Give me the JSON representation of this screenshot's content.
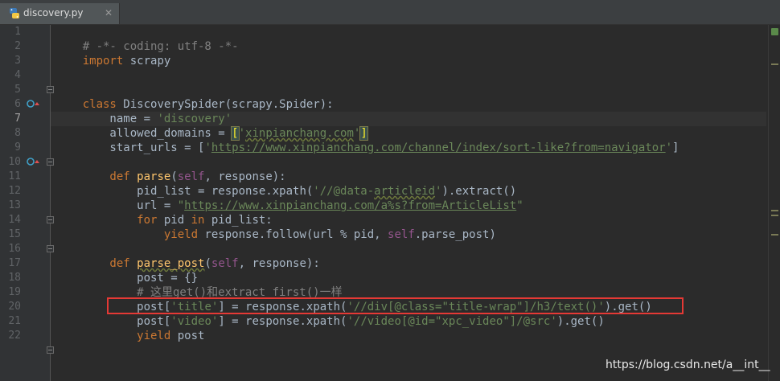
{
  "tab": {
    "filename": "discovery.py",
    "close_glyph": "✕",
    "icon": "python-file-icon"
  },
  "line_numbers": [
    "1",
    "2",
    "3",
    "4",
    "5",
    "6",
    "7",
    "8",
    "9",
    "10",
    "11",
    "12",
    "13",
    "14",
    "15",
    "16",
    "17",
    "18",
    "19",
    "20",
    "21",
    "22"
  ],
  "current_line": "7",
  "code": {
    "l1": "# -*- coding: utf-8 -*-",
    "l2_kw": "import",
    "l2_rest": " scrapy",
    "l5_kw": "class",
    "l5_rest": " DiscoverySpider(scrapy.Spider):",
    "l6_a": "    name = ",
    "l6_str": "'discovery'",
    "l7_a": "    allowed_domains = ",
    "l7_lb": "[",
    "l7_q1": "'",
    "l7_dom": "xinpianchang.com",
    "l7_q2": "'",
    "l7_rb": "]",
    "l8_a": "    start_urls = [",
    "l8_q1": "'",
    "l8_url": "https://www.xinpianchang.com/channel/index/sort-like?from=navigator",
    "l8_q2": "'",
    "l8_b": "]",
    "l10_kw": "    def ",
    "l10_fn": "parse",
    "l10_b": "(",
    "l10_self": "self",
    "l10_c": ", response):",
    "l11_a": "        pid_list = response.xpath(",
    "l11_s1": "'//@data-",
    "l11_s2": "articleid",
    "l11_s3": "'",
    "l11_b": ").extract()",
    "l12_a": "        url = ",
    "l12_q1": "\"",
    "l12_url": "https://www.xinpianchang.com/a%s?from=ArticleList",
    "l12_q2": "\"",
    "l13_kw1": "        for",
    "l13_a": " pid ",
    "l13_kw2": "in",
    "l13_b": " pid_list:",
    "l14_kw": "            yield",
    "l14_a": " response.follow(url % pid, ",
    "l14_self": "self",
    "l14_b": ".parse_post)",
    "l16_kw": "    def ",
    "l16_fn": "parse_post",
    "l16_b": "(",
    "l16_self": "self",
    "l16_c": ", response):",
    "l17_a": "        post = {}",
    "l18": "        # 这里get()和extract_first()一样",
    "l19_a": "        post[",
    "l19_s": "'title'",
    "l19_b": "] = response.xpath(",
    "l19_s2": "'//div[@class=\"title-wrap\"]/h3/text()'",
    "l19_c": ").get()",
    "l20_a": "        post[",
    "l20_s": "'video'",
    "l20_b": "] = response.xpath(",
    "l20_s2": "'//video[@id=\"xpc_video\"]/@src'",
    "l20_c": ").get()",
    "l21_kw": "        yield",
    "l21_a": " post"
  },
  "watermark": "https://blog.csdn.net/a__int__",
  "colors": {
    "background": "#2b2b2b",
    "keyword": "#cc7832",
    "string": "#6a8759",
    "comment": "#808080",
    "function": "#ffc66d",
    "self": "#94558d",
    "highlight_box": "#e53935"
  }
}
